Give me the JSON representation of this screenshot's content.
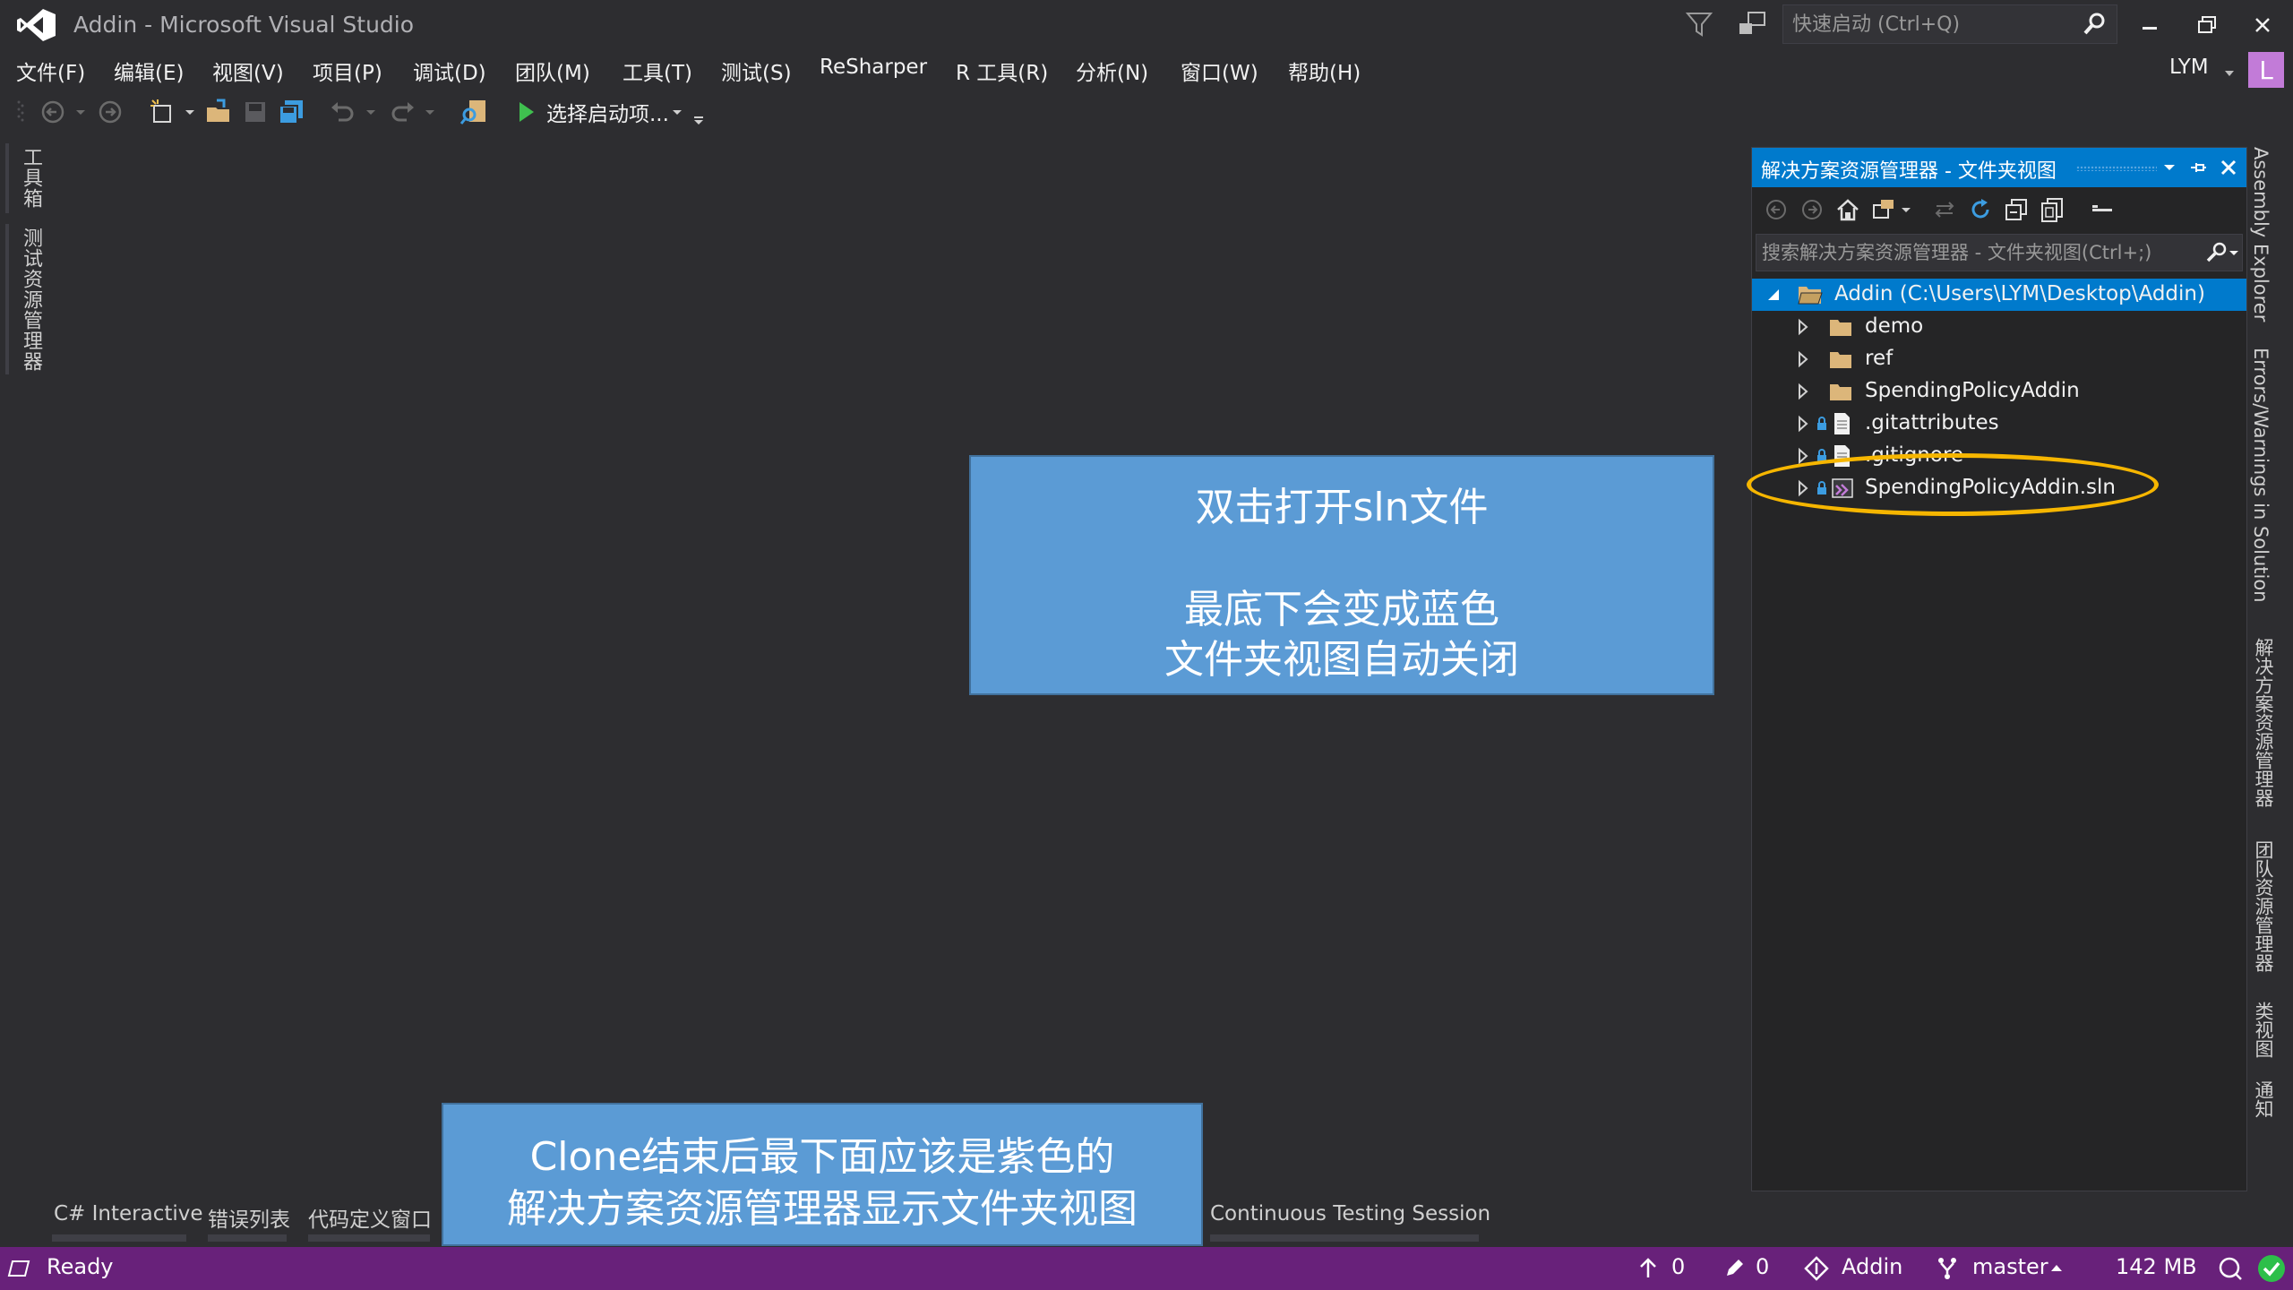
{
  "window": {
    "title": "Addin - Microsoft Visual Studio"
  },
  "quick_launch": {
    "placeholder": "快速启动 (Ctrl+Q)"
  },
  "menu": {
    "items": [
      "文件(F)",
      "编辑(E)",
      "视图(V)",
      "项目(P)",
      "调试(D)",
      "团队(M)",
      "工具(T)",
      "测试(S)",
      "ReSharper",
      "R 工具(R)",
      "分析(N)",
      "窗口(W)",
      "帮助(H)"
    ]
  },
  "user": {
    "name": "LYM",
    "initial": "L"
  },
  "toolbar": {
    "start_label": "选择启动项..."
  },
  "left_tabs": [
    "工具箱",
    "测试资源管理器"
  ],
  "right_tabs": [
    "Assembly Explorer",
    "Errors/Warnings in Solution",
    "解决方案资源管理器",
    "团队资源管理器",
    "类视图",
    "通知"
  ],
  "solution_explorer": {
    "title": "解决方案资源管理器 - 文件夹视图",
    "search_placeholder": "搜索解决方案资源管理器 - 文件夹视图(Ctrl+;)",
    "root": "Addin (C:\\Users\\LYM\\Desktop\\Addin)",
    "items": [
      {
        "label": "demo",
        "type": "folder"
      },
      {
        "label": "ref",
        "type": "folder"
      },
      {
        "label": "SpendingPolicyAddin",
        "type": "folder"
      },
      {
        "label": ".gitattributes",
        "type": "file"
      },
      {
        "label": ".gitignore",
        "type": "file"
      },
      {
        "label": "SpendingPolicyAddin.sln",
        "type": "solution"
      }
    ]
  },
  "callouts": {
    "top": {
      "line1": "双击打开sln文件",
      "line2": "最底下会变成蓝色",
      "line3": "文件夹视图自动关闭"
    },
    "bottom": {
      "line1": "Clone结束后最下面应该是紫色的",
      "line2": "解决方案资源管理器显示文件夹视图"
    }
  },
  "bottom_tabs": [
    "C# Interactive",
    "错误列表",
    "代码定义窗口",
    "Continuous Testing Session"
  ],
  "status": {
    "ready": "Ready",
    "push_count": "0",
    "pending_changes": "0",
    "repo": "Addin",
    "branch": "master",
    "memory": "142 MB"
  },
  "colors": {
    "accent": "#007acc",
    "statusbar": "#68217a",
    "callout": "#5b9bd5",
    "highlight": "#f6b600",
    "folder": "#dcb67a"
  }
}
